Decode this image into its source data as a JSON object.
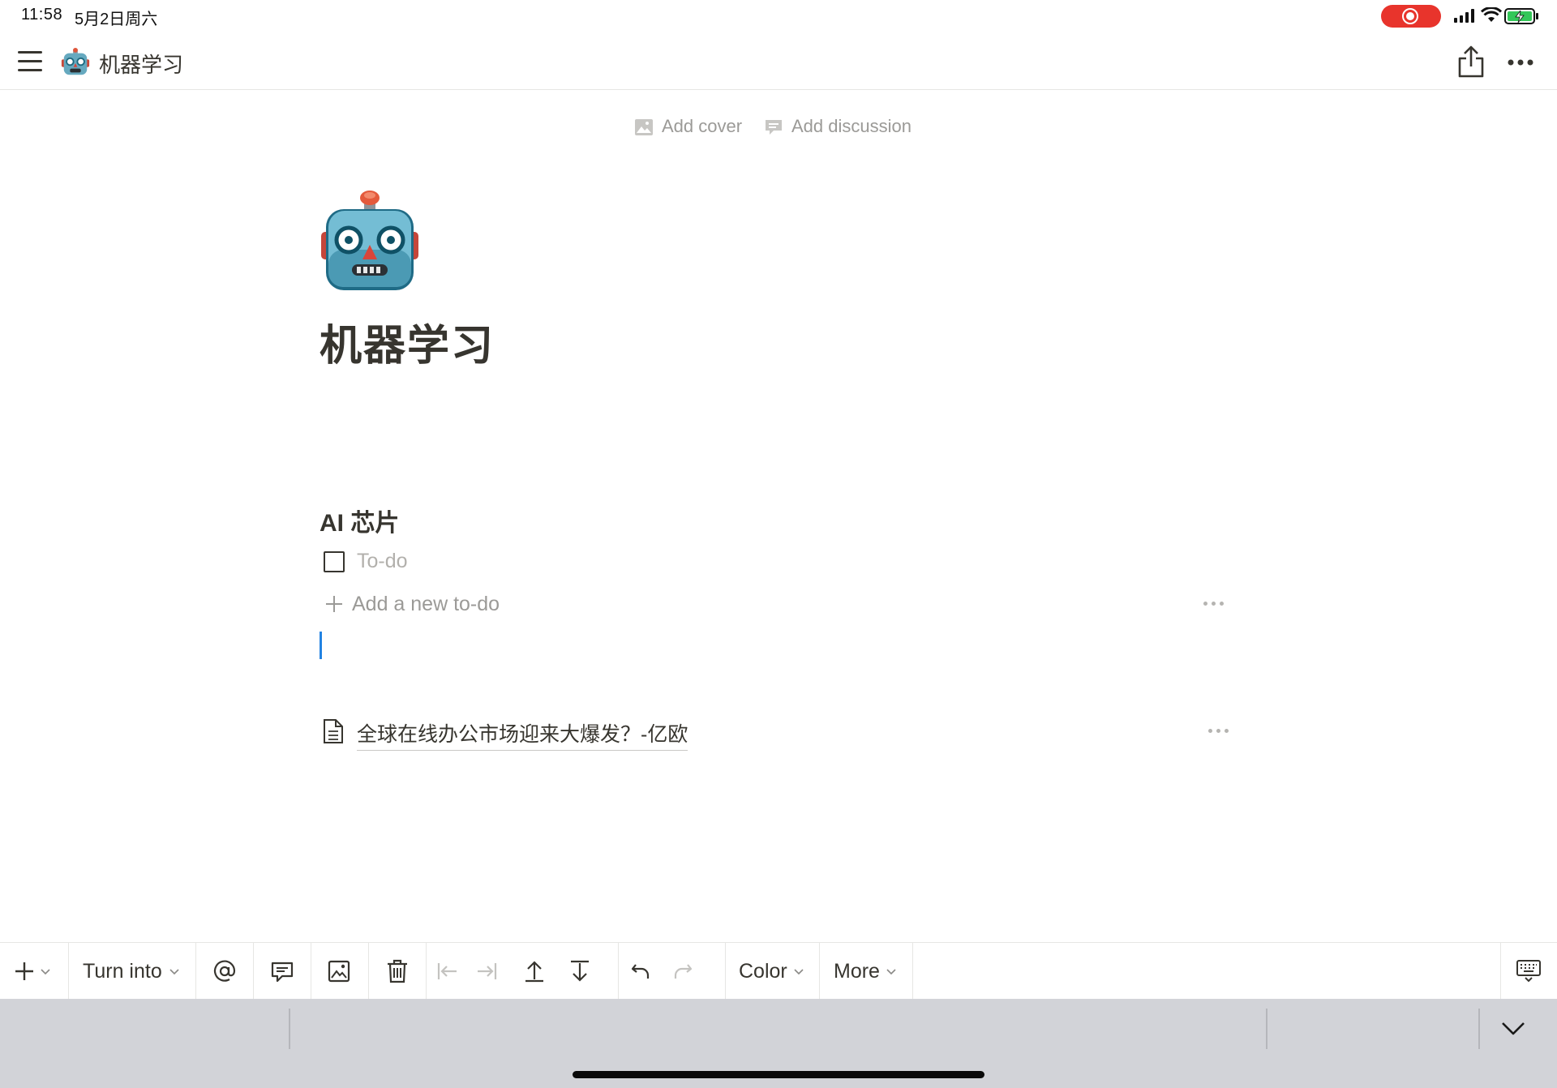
{
  "status_bar": {
    "time": "11:58",
    "date": "5月2日周六"
  },
  "header": {
    "breadcrumb_icon": "robot-emoji",
    "breadcrumb_title": "机器学习"
  },
  "page_actions": {
    "add_cover": "Add cover",
    "add_discussion": "Add discussion"
  },
  "page": {
    "icon": "robot-emoji",
    "title": "机器学习",
    "heading": "AI 芯片",
    "todo_placeholder": "To-do",
    "add_todo_label": "Add a new to-do",
    "linked_page_title": "全球在线办公市场迎来大爆发？-亿欧"
  },
  "toolbar": {
    "turn_into_label": "Turn into",
    "color_label": "Color",
    "more_label": "More"
  },
  "colors": {
    "recording": "#e8342c",
    "cursor": "#2383e2",
    "keyboard_bg": "#d2d3d8",
    "text": "#37352f",
    "muted": "#9b9a97"
  }
}
